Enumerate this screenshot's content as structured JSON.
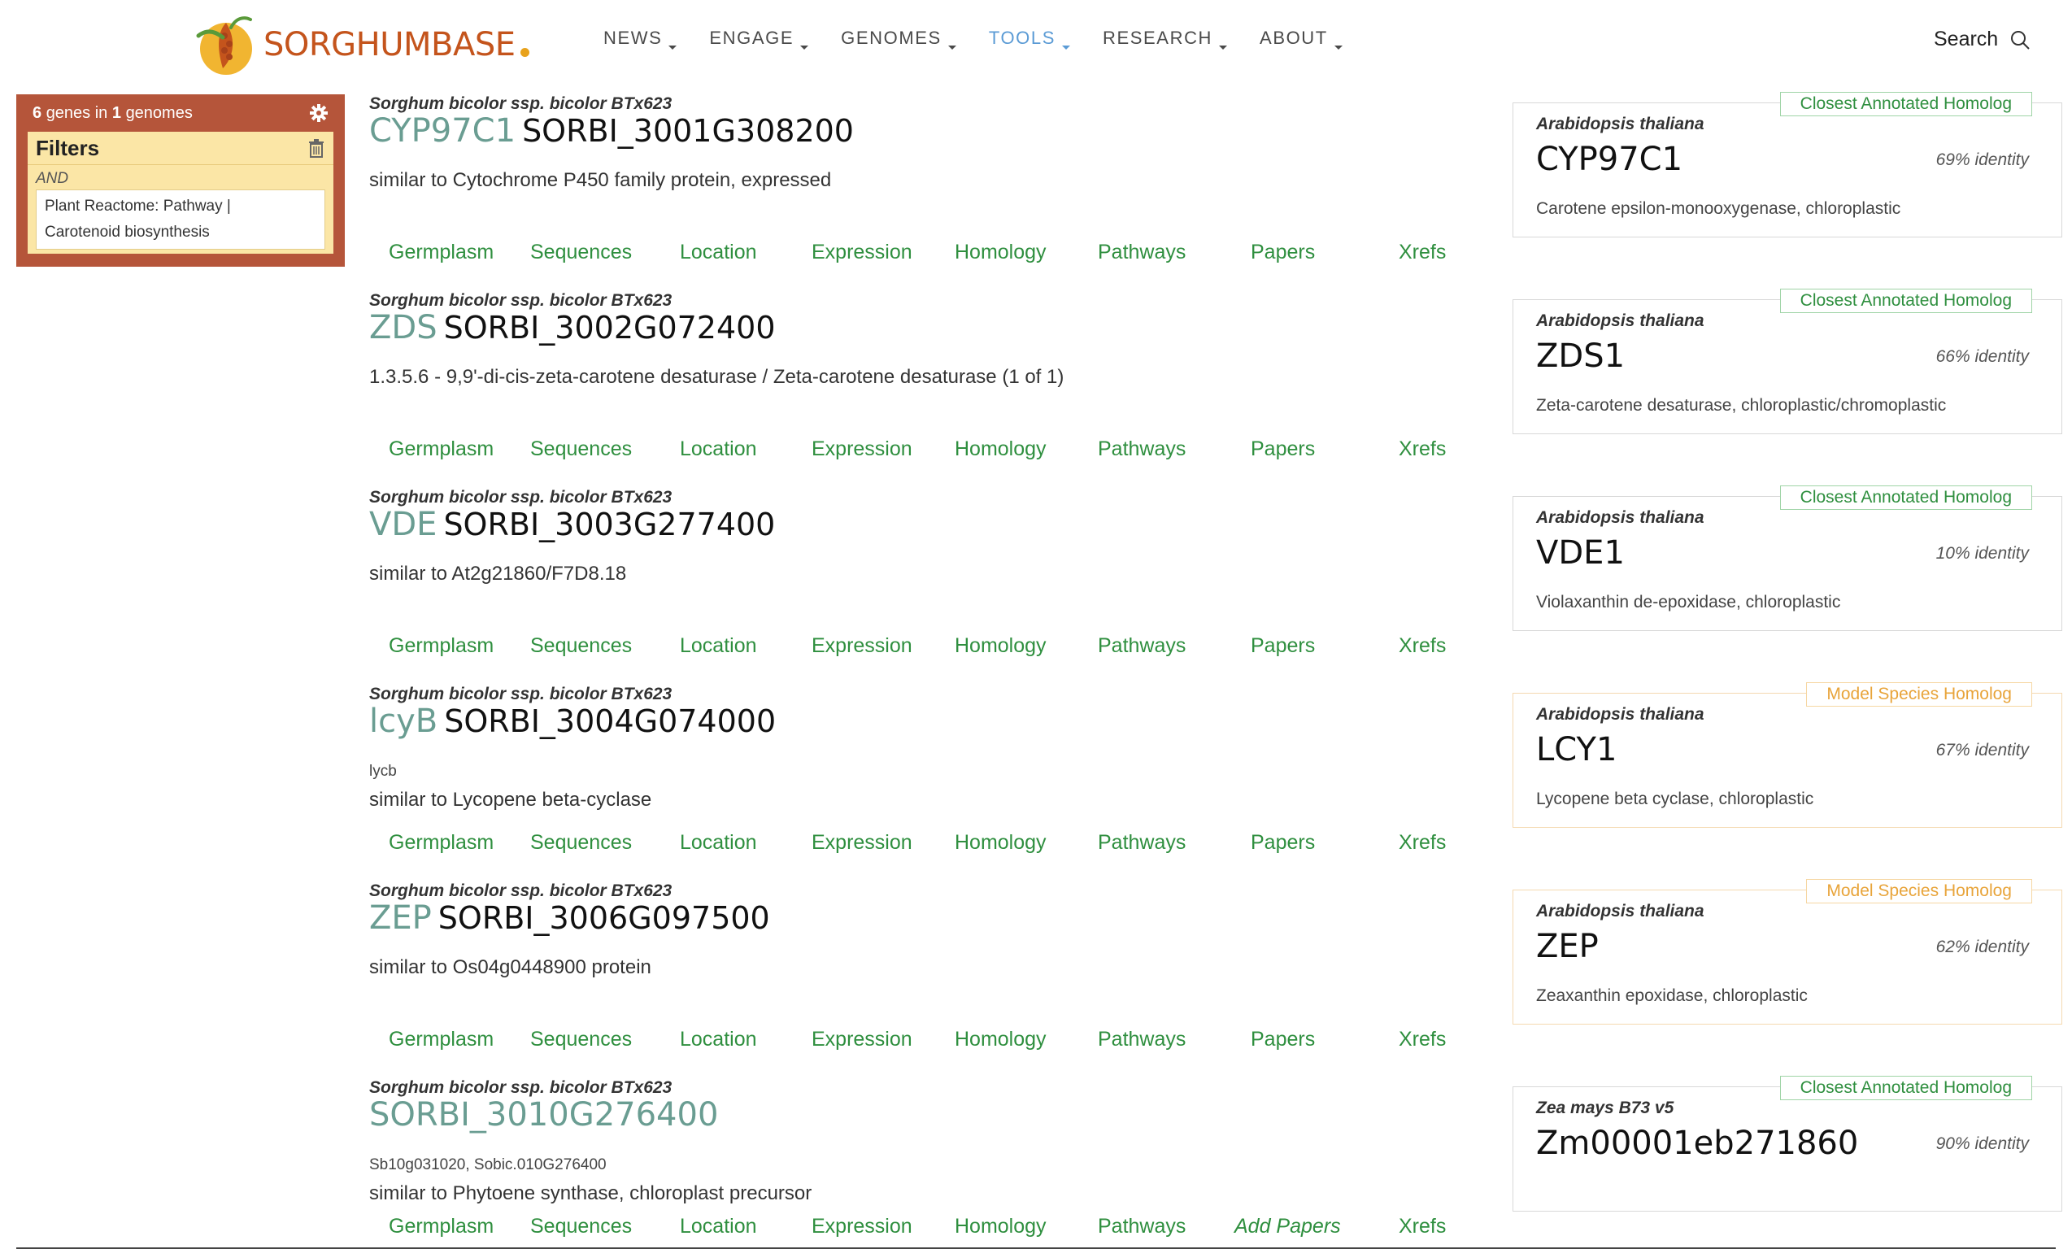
{
  "header": {
    "logo_text": "SORGHUMBASE",
    "nav": [
      "NEWS",
      "ENGAGE",
      "GENOMES",
      "TOOLS",
      "RESEARCH",
      "ABOUT"
    ],
    "active_nav": "TOOLS",
    "search_label": "Search"
  },
  "filters": {
    "count_genes": "6",
    "count_mid": "genes in",
    "count_genomes": "1",
    "count_tail": "genomes",
    "title": "Filters",
    "operator": "AND",
    "filter_line1": "Plant Reactome: Pathway |",
    "filter_line2": "Carotenoid biosynthesis"
  },
  "tabs": [
    "Germplasm",
    "Sequences",
    "Location",
    "Expression",
    "Homology",
    "Pathways",
    "Papers",
    "Xrefs"
  ],
  "genes": [
    {
      "species": "Sorghum bicolor ssp. bicolor BTx623",
      "name": "CYP97C1",
      "id": "SORBI_3001G308200",
      "synonyms": "",
      "description": "similar to Cytochrome P450 family protein, expressed",
      "papers_label": "Papers",
      "homolog": {
        "type": "Closest Annotated Homolog",
        "species": "Arabidopsis thaliana",
        "name": "CYP97C1",
        "identity": "69% identity",
        "description": "Carotene epsilon-monooxygenase, chloroplastic"
      }
    },
    {
      "species": "Sorghum bicolor ssp. bicolor BTx623",
      "name": "ZDS",
      "id": "SORBI_3002G072400",
      "synonyms": "",
      "description": "1.3.5.6 - 9,9'-di-cis-zeta-carotene desaturase / Zeta-carotene desaturase (1 of 1)",
      "papers_label": "Papers",
      "homolog": {
        "type": "Closest Annotated Homolog",
        "species": "Arabidopsis thaliana",
        "name": "ZDS1",
        "identity": "66% identity",
        "description": "Zeta-carotene desaturase, chloroplastic/chromoplastic"
      }
    },
    {
      "species": "Sorghum bicolor ssp. bicolor BTx623",
      "name": "VDE",
      "id": "SORBI_3003G277400",
      "synonyms": "",
      "description": "similar to At2g21860/F7D8.18",
      "papers_label": "Papers",
      "homolog": {
        "type": "Closest Annotated Homolog",
        "species": "Arabidopsis thaliana",
        "name": "VDE1",
        "identity": "10% identity",
        "description": "Violaxanthin de-epoxidase, chloroplastic"
      }
    },
    {
      "species": "Sorghum bicolor ssp. bicolor BTx623",
      "name": "lcyB",
      "id": "SORBI_3004G074000",
      "synonyms": "lycb",
      "description": "similar to Lycopene beta-cyclase",
      "papers_label": "Papers",
      "homolog": {
        "type": "Model Species Homolog",
        "species": "Arabidopsis thaliana",
        "name": "LCY1",
        "identity": "67% identity",
        "description": "Lycopene beta cyclase, chloroplastic"
      }
    },
    {
      "species": "Sorghum bicolor ssp. bicolor BTx623",
      "name": "ZEP",
      "id": "SORBI_3006G097500",
      "synonyms": "",
      "description": "similar to Os04g0448900 protein",
      "papers_label": "Papers",
      "homolog": {
        "type": "Model Species Homolog",
        "species": "Arabidopsis thaliana",
        "name": "ZEP",
        "identity": "62% identity",
        "description": "Zeaxanthin epoxidase, chloroplastic"
      }
    },
    {
      "species": "Sorghum bicolor ssp. bicolor BTx623",
      "name": "SORBI_3010G276400",
      "id": "",
      "synonyms": "Sb10g031020, Sobic.010G276400",
      "description": "similar to Phytoene synthase, chloroplast precursor",
      "papers_label": "Add Papers",
      "homolog": {
        "type": "Closest Annotated Homolog",
        "species": "Zea mays B73 v5",
        "name": "Zm00001eb271860",
        "identity": "90% identity",
        "description": ""
      }
    }
  ]
}
